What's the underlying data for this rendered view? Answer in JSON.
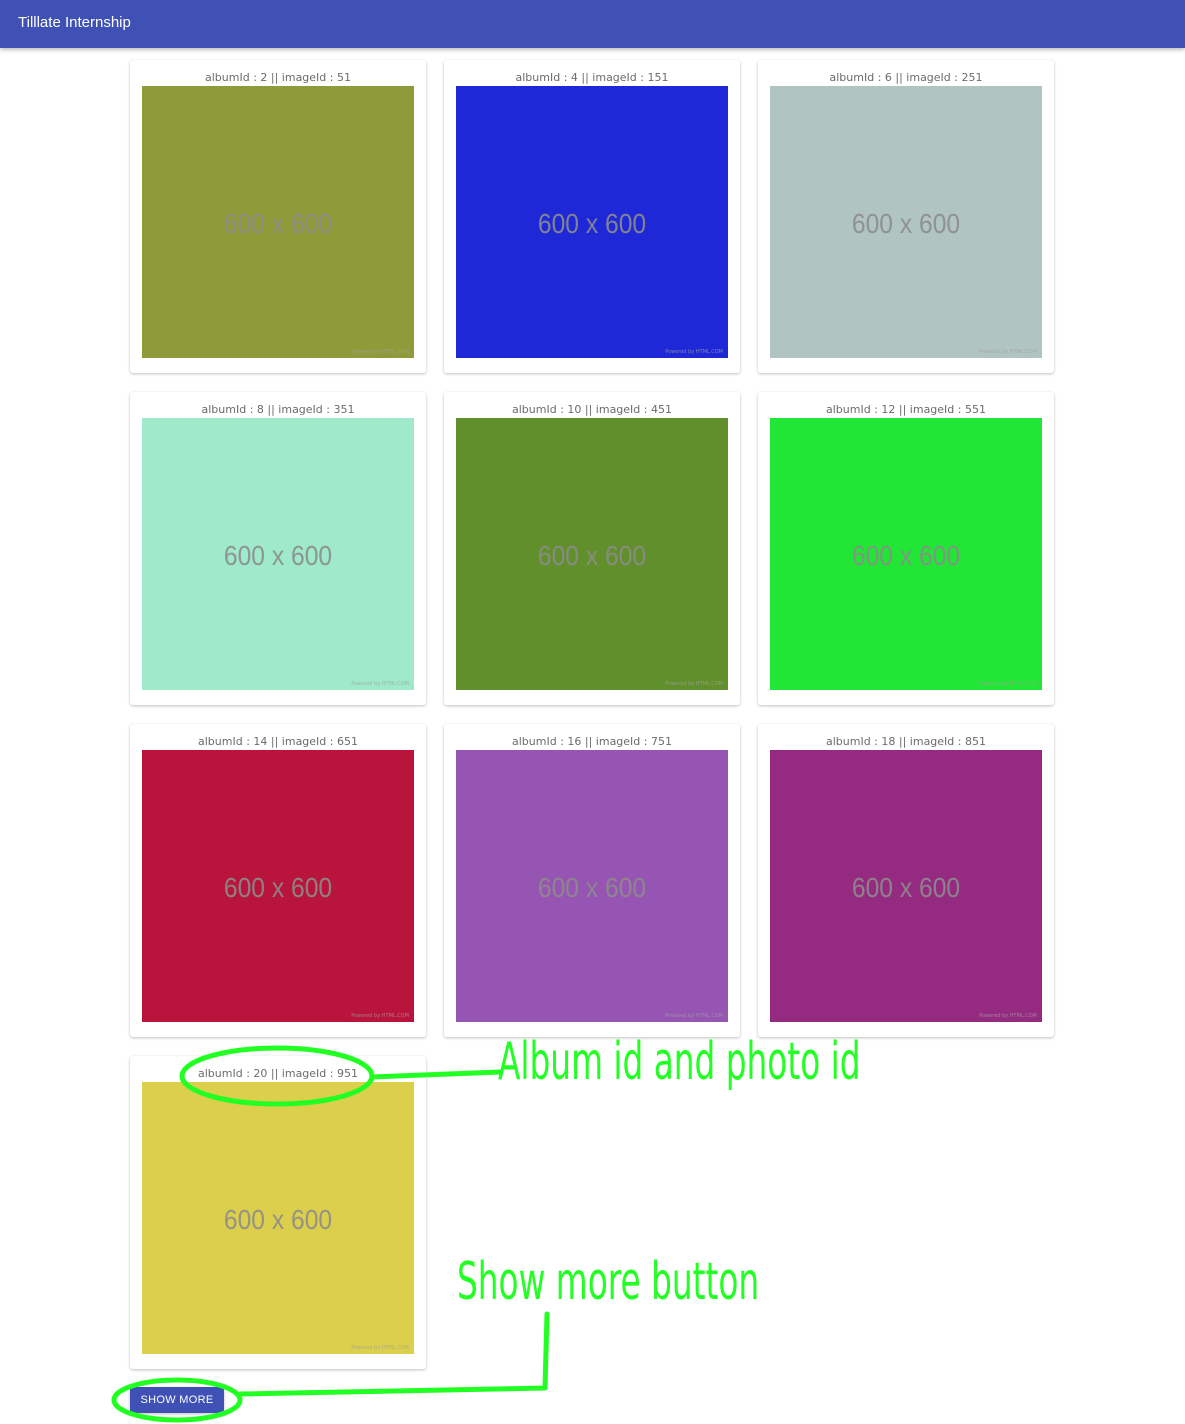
{
  "app_bar": {
    "title": "Tilllate Internship",
    "color": "#3f51b5"
  },
  "cards": [
    {
      "caption": "albumId : 2 || imageId : 51",
      "image_text": "600 x 600",
      "powered": "Powered by HTML.COM",
      "color": "#8f9a39"
    },
    {
      "caption": "albumId : 4 || imageId : 151",
      "image_text": "600 x 600",
      "powered": "Powered by HTML.COM",
      "color": "#1e28d6"
    },
    {
      "caption": "albumId : 6 || imageId : 251",
      "image_text": "600 x 600",
      "powered": "Powered by HTML.COM",
      "color": "#b0c5c2"
    },
    {
      "caption": "albumId : 8 || imageId : 351",
      "image_text": "600 x 600",
      "powered": "Powered by HTML.COM",
      "color": "#9eeaca"
    },
    {
      "caption": "albumId : 10 || imageId : 451",
      "image_text": "600 x 600",
      "powered": "Powered by HTML.COM",
      "color": "#618f2c"
    },
    {
      "caption": "albumId : 12 || imageId : 551",
      "image_text": "600 x 600",
      "powered": "Powered by HTML.COM",
      "color": "#22e635"
    },
    {
      "caption": "albumId : 14 || imageId : 651",
      "image_text": "600 x 600",
      "powered": "Powered by HTML.COM",
      "color": "#b9153c"
    },
    {
      "caption": "albumId : 16 || imageId : 751",
      "image_text": "600 x 600",
      "powered": "Powered by HTML.COM",
      "color": "#9655b3"
    },
    {
      "caption": "albumId : 18 || imageId : 851",
      "image_text": "600 x 600",
      "powered": "Powered by HTML.COM",
      "color": "#952b80"
    },
    {
      "caption": "albumId : 20 || imageId : 951",
      "image_text": "600 x 600",
      "powered": "Powered by HTML.COM",
      "color": "#dccf4b"
    }
  ],
  "show_more_button": {
    "label": "SHOW MORE"
  },
  "annotations": {
    "album_photo_id_label": "Album id and photo id",
    "show_more_label": "Show more button",
    "color": "#22ff22"
  }
}
